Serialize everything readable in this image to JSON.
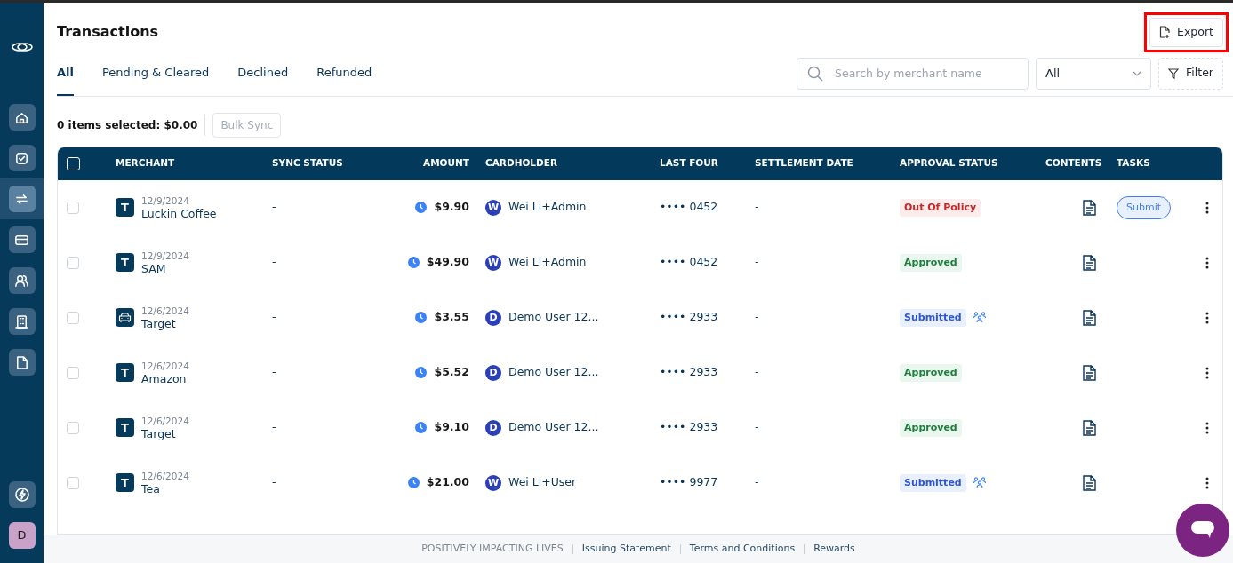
{
  "sidebar": {
    "items": [
      {
        "selected": false
      },
      {
        "selected": false
      },
      {
        "selected": true
      },
      {
        "selected": false
      },
      {
        "selected": false
      },
      {
        "selected": false
      },
      {
        "selected": false
      }
    ],
    "avatar": "D"
  },
  "title": "Transactions",
  "export_button": "Export",
  "tabs": [
    {
      "label": "All",
      "selected": true
    },
    {
      "label": "Pending & Cleared",
      "selected": false
    },
    {
      "label": "Declined",
      "selected": false
    },
    {
      "label": "Refunded",
      "selected": false
    }
  ],
  "search": {
    "placeholder": "Search by merchant name"
  },
  "status_select": {
    "value": "All"
  },
  "filter_button": "Filter",
  "selection_summary": "0 items selected: $0.00",
  "bulk_sync_button": {
    "label": "Bulk Sync",
    "disabled": true
  },
  "table": {
    "header_checked": false,
    "columns": [
      "MERCHANT",
      "SYNC STATUS",
      "AMOUNT",
      "CARDHOLDER",
      "LAST FOUR",
      "SETTLEMENT DATE",
      "APPROVAL STATUS",
      "CONTENTS",
      "TASKS"
    ],
    "rows": [
      {
        "checked": false,
        "date": "12/9/2024",
        "merchant": "Luckin Coffee",
        "merchant_icon": {
          "kind": "letter",
          "letter": "T"
        },
        "sync_status": "-",
        "amount": "$9.90",
        "cardholder_initial": "W",
        "cardholder": "Wei Li+Admin",
        "last_four": "•••• 0452",
        "settlement_date": "-",
        "approval": {
          "label": "Out Of Policy",
          "kind": "out_of_policy"
        },
        "group_review": false,
        "task": "Submit"
      },
      {
        "checked": false,
        "date": "12/9/2024",
        "merchant": "SAM",
        "merchant_icon": {
          "kind": "letter",
          "letter": "T"
        },
        "sync_status": "-",
        "amount": "$49.90",
        "cardholder_initial": "W",
        "cardholder": "Wei Li+Admin",
        "last_four": "•••• 0452",
        "settlement_date": "-",
        "approval": {
          "label": "Approved",
          "kind": "approved"
        },
        "group_review": false
      },
      {
        "checked": false,
        "date": "12/6/2024",
        "merchant": "Target",
        "merchant_icon": {
          "kind": "car"
        },
        "sync_status": "-",
        "amount": "$3.55",
        "cardholder_initial": "D",
        "cardholder": "Demo User 12...",
        "last_four": "•••• 2933",
        "settlement_date": "-",
        "approval": {
          "label": "Submitted",
          "kind": "submitted"
        },
        "group_review": true
      },
      {
        "checked": false,
        "date": "12/6/2024",
        "merchant": "Amazon",
        "merchant_icon": {
          "kind": "letter",
          "letter": "T"
        },
        "sync_status": "-",
        "amount": "$5.52",
        "cardholder_initial": "D",
        "cardholder": "Demo User 12...",
        "last_four": "•••• 2933",
        "settlement_date": "-",
        "approval": {
          "label": "Approved",
          "kind": "approved"
        },
        "group_review": false
      },
      {
        "checked": false,
        "date": "12/6/2024",
        "merchant": "Target",
        "merchant_icon": {
          "kind": "letter",
          "letter": "T"
        },
        "sync_status": "-",
        "amount": "$9.10",
        "cardholder_initial": "D",
        "cardholder": "Demo User 12...",
        "last_four": "•••• 2933",
        "settlement_date": "-",
        "approval": {
          "label": "Approved",
          "kind": "approved"
        },
        "group_review": false
      },
      {
        "checked": false,
        "date": "12/6/2024",
        "merchant": "Tea",
        "merchant_icon": {
          "kind": "letter",
          "letter": "T"
        },
        "sync_status": "-",
        "amount": "$21.00",
        "cardholder_initial": "W",
        "cardholder": "Wei Li+User",
        "last_four": "•••• 9977",
        "settlement_date": "-",
        "approval": {
          "label": "Submitted",
          "kind": "submitted"
        },
        "group_review": true
      }
    ]
  },
  "footer": [
    "POSITIVELY IMPACTING LIVES",
    "Issuing Statement",
    "Terms and Conditions",
    "Rewards"
  ]
}
